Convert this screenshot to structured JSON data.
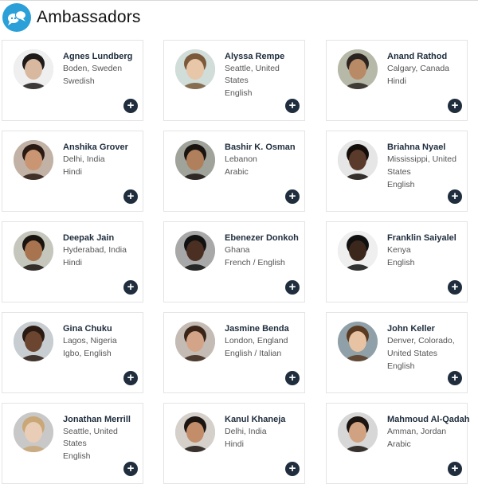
{
  "header": {
    "title": "Ambassadors",
    "logo_icon": "chat-bubbles-logo-icon"
  },
  "accent_color": "#2a9fd8",
  "button_color": "#1f2d3d",
  "add_icon_glyph": "+",
  "ambassadors": [
    {
      "name": "Agnes Lundberg",
      "lines": [
        "Boden, Sweden",
        "Swedish"
      ]
    },
    {
      "name": "Alyssa Rempe",
      "lines": [
        "Seattle, United States",
        "English"
      ]
    },
    {
      "name": "Anand Rathod",
      "lines": [
        "Calgary, Canada",
        "Hindi"
      ]
    },
    {
      "name": "Anshika Grover",
      "lines": [
        "Delhi, India",
        "Hindi"
      ]
    },
    {
      "name": "Bashir K. Osman",
      "lines": [
        "Lebanon",
        "Arabic"
      ]
    },
    {
      "name": "Briahna Nyael",
      "lines": [
        "Mississippi, United",
        "States",
        "English"
      ]
    },
    {
      "name": "Deepak Jain",
      "lines": [
        "Hyderabad, India",
        "Hindi"
      ]
    },
    {
      "name": "Ebenezer Donkoh",
      "lines": [
        "Ghana",
        "French / English"
      ]
    },
    {
      "name": "Franklin Saiyalel",
      "lines": [
        "Kenya",
        "English"
      ]
    },
    {
      "name": "Gina Chuku",
      "lines": [
        "Lagos, Nigeria",
        "Igbo, English"
      ]
    },
    {
      "name": "Jasmine Benda",
      "lines": [
        "London, England",
        "English / Italian"
      ]
    },
    {
      "name": "John Keller",
      "lines": [
        "Denver, Colorado,",
        "United States",
        "English"
      ]
    },
    {
      "name": "Jonathan Merrill",
      "lines": [
        "Seattle, United States",
        "English"
      ]
    },
    {
      "name": "Kanul Khaneja",
      "lines": [
        "Delhi, India",
        "Hindi"
      ]
    },
    {
      "name": "Mahmoud Al-Qadah",
      "lines": [
        "Amman, Jordan",
        "Arabic"
      ]
    }
  ]
}
